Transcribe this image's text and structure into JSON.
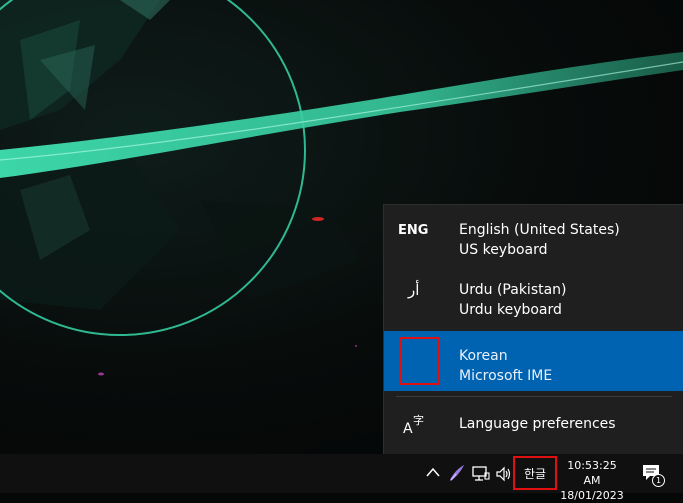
{
  "language_menu": {
    "items": [
      {
        "code": "ENG",
        "name": "English (United States)",
        "keyboard": "US keyboard",
        "selected": false
      },
      {
        "code": "أر",
        "name": "Urdu (Pakistan)",
        "keyboard": "Urdu keyboard",
        "selected": false
      },
      {
        "code": "",
        "name": "Korean",
        "keyboard": "Microsoft IME",
        "selected": true
      }
    ],
    "preferences_label": "Language preferences",
    "preferences_icon": "language-settings-icon"
  },
  "taskbar": {
    "tray_icons": [
      "chevron-up-icon",
      "pen-icon",
      "network-icon",
      "volume-icon"
    ],
    "ime_indicator": "한글",
    "clock_time": "10:53:25 AM",
    "clock_date": "18/01/2023",
    "notification_count": "1"
  },
  "colors": {
    "selected_background": "#0063b1",
    "flyout_background": "#1f1f1f",
    "taskbar_background": "#101010",
    "highlight_box": "#e01010",
    "wallpaper_accent": "#3fe0b0"
  }
}
